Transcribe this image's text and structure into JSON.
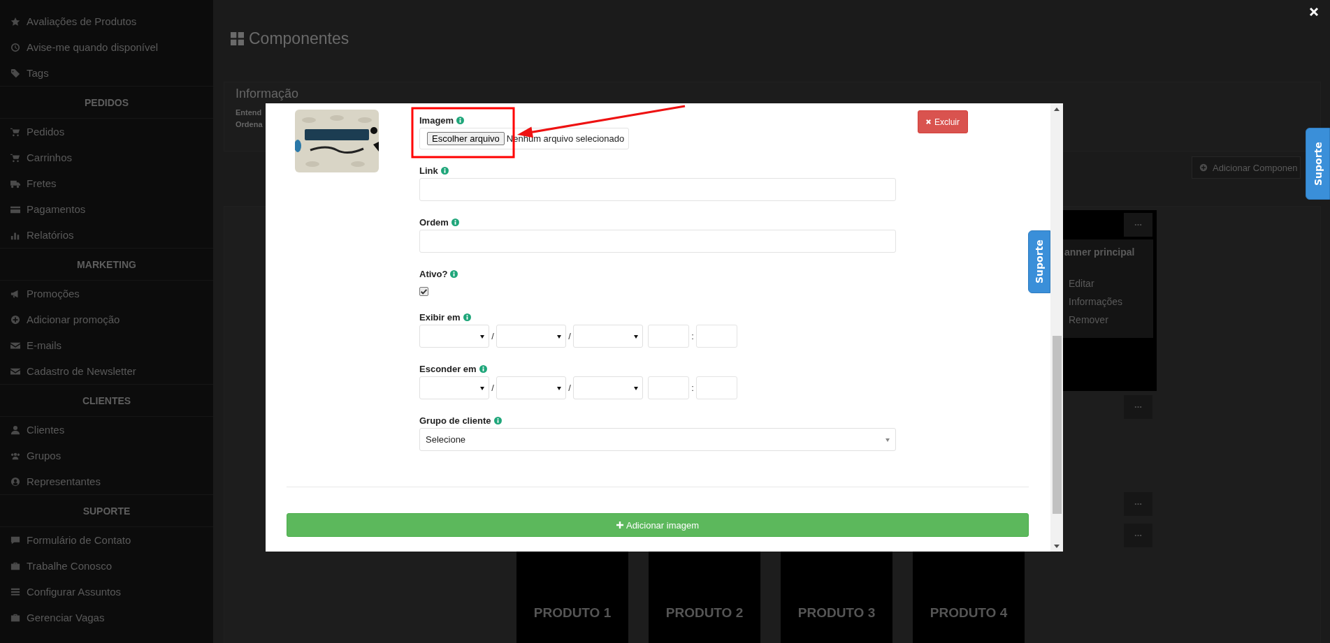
{
  "sidebar": {
    "sections": [
      {
        "items": [
          "Avaliações de Produtos",
          "Avise-me quando disponível",
          "Tags"
        ]
      },
      {
        "heading": "PEDIDOS",
        "items": [
          "Pedidos",
          "Carrinhos",
          "Fretes",
          "Pagamentos",
          "Relatórios"
        ]
      },
      {
        "heading": "MARKETING",
        "items": [
          "Promoções",
          "Adicionar promoção",
          "E-mails",
          "Cadastro de Newsletter"
        ]
      },
      {
        "heading": "CLIENTES",
        "items": [
          "Clientes",
          "Grupos",
          "Representantes"
        ]
      },
      {
        "heading": "SUPORTE",
        "items": [
          "Formulário de Contato",
          "Trabalhe Conosco",
          "Configurar Assuntos",
          "Gerenciar Vagas"
        ]
      }
    ]
  },
  "page": {
    "title": "Componentes",
    "info_panel": {
      "title": "Informação",
      "lines": [
        "Entend",
        "Ordena"
      ]
    },
    "add_component_button": "Adicionar Componen",
    "banner_card": {
      "title": "anner principal",
      "actions": [
        "Editar",
        "Informações",
        "Remover"
      ]
    },
    "products": [
      "PRODUTO 1",
      "PRODUTO 2",
      "PRODUTO 3",
      "PRODUTO 4"
    ]
  },
  "modal": {
    "delete_button": "Excluir",
    "fields": [
      {
        "kind": "file",
        "label": "Imagem",
        "button": "Escolher arquivo",
        "status": "Nenhum arquivo selecionado"
      },
      {
        "kind": "text",
        "label": "Link"
      },
      {
        "kind": "text",
        "label": "Ordem"
      },
      {
        "kind": "checkbox",
        "label": "Ativo?",
        "checked": true
      },
      {
        "kind": "datetime",
        "label": "Exibir em",
        "separators": [
          "/",
          "/",
          ":"
        ]
      },
      {
        "kind": "datetime",
        "label": "Esconder em",
        "separators": [
          "/",
          "/",
          ":"
        ]
      },
      {
        "kind": "select",
        "label": "Grupo de cliente",
        "value": "Selecione"
      }
    ],
    "add_image_button": "Adicionar imagem"
  },
  "support_tabs": [
    "Suporte",
    "Suporte"
  ]
}
